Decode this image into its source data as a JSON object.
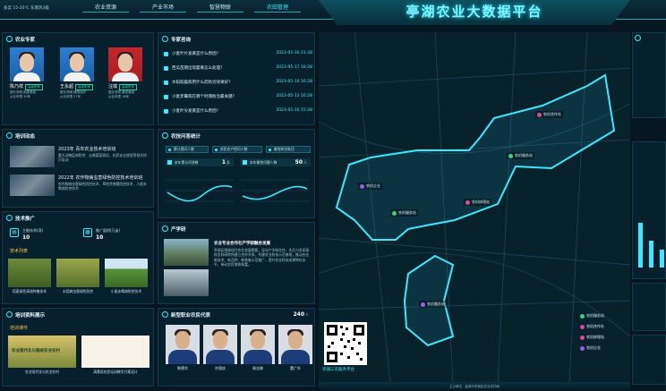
{
  "topbar": {
    "weather": "多云 15-20℃ 东南风3级",
    "nav": [
      {
        "label": "农业资源",
        "active": false
      },
      {
        "label": "产业市场",
        "active": false
      },
      {
        "label": "智慧物联",
        "active": false
      },
      {
        "label": "农田管理",
        "active": true
      }
    ],
    "title": "亭湖农业大数据平台"
  },
  "experts": {
    "title": "农业专家",
    "items": [
      {
        "name": "陈乃祥",
        "badge": "高级职称",
        "meta1": "擅长领域 稻麦栽培",
        "meta2": "从业年限 30年"
      },
      {
        "name": "王永超",
        "badge": "高级职称",
        "meta1": "擅长领域 植物保护",
        "meta2": "从业年限 27年"
      },
      {
        "name": "汪琪",
        "badge": "高级职称",
        "meta1": "擅长领域 蔬菜栽培",
        "meta2": "从业年限 18年"
      }
    ]
  },
  "training": {
    "title": "培训动态",
    "items": [
      {
        "title": "2023年 青年农业技术培训班",
        "text": "重大动物疫病防控、瓜果蔬菜栽培、农药安全使用等相关知识培训"
      },
      {
        "title": "2022年 农作物病虫害绿色防控技术培训班",
        "text": "农作物病虫害绿色防控技术、草地贪夜蛾防控技术、小麦赤霉病防控技术"
      }
    ]
  },
  "tech": {
    "title": "技术推广",
    "stat1": {
      "label": "主推技术(项)",
      "value": "10"
    },
    "stat2": {
      "label": "推广面积(万亩)",
      "value": "10"
    },
    "sub_head": "技术列表",
    "pictures": [
      {
        "caption": "稻麦绿色高效种植技术"
      },
      {
        "caption": "水稻病虫害绿色防控"
      },
      {
        "caption": "小麦赤霉病防控技术"
      }
    ]
  },
  "training_info": {
    "title": "培训资料展示",
    "sub_head": "培训课件",
    "cards": [
      {
        "title": "农业现代化与推进农业农村",
        "caption": "农业现代化与农业农村"
      },
      {
        "caption": "高素质农民培训教学方案设计"
      }
    ]
  },
  "consult": {
    "title": "专家咨询",
    "rows": [
      {
        "text": "小麦叶片发黄是什么原因?",
        "date": "2023-05-16 21:28"
      },
      {
        "text": "西瓜苗期出现萎蔫怎么处理?",
        "date": "2023-05-17 18:28"
      },
      {
        "text": "水稻稻瘟病用什么药防治效果好?",
        "date": "2023-05-14 16:28"
      },
      {
        "text": "小麦赤霉病在哪个时期防治最关键?",
        "date": "2023-05-13 16:28"
      },
      {
        "text": "小麦叶尖发黄是什么原因?",
        "date": "2023-05-10 15:28"
      }
    ]
  },
  "qa_stats": {
    "title": "农技问答统计",
    "tabs": [
      "累计提问人数",
      "农民农户提问人数",
      "解答知识条目"
    ],
    "stat1": {
      "label": "本年累计问答数",
      "value": "1",
      "unit": "条"
    },
    "stat2": {
      "label": "本年解答问题人数",
      "value": "50",
      "unit": "人"
    }
  },
  "industry": {
    "title": "产学研",
    "headline": "农业专业合作社产学研融合发展",
    "text": "亭湖区围绕现代农业发展需要，深化产学研合作，先后与多家高校及科研院所建立合作关系，共建农业科技示范基地，推动农业新技术、新品种、新装备示范推广，提升农业科技成果转化水平，带动农民增收致富。"
  },
  "members": {
    "title": "新型职业农民代表",
    "count": "240",
    "unit": "人",
    "people": [
      {
        "name": "陈德华"
      },
      {
        "name": "许国庆"
      },
      {
        "name": "周志刚"
      },
      {
        "name": "董广升"
      }
    ]
  },
  "map": {
    "labels": [
      {
        "text": "农机合作社",
        "tone": "#d94b9b"
      },
      {
        "text": "农机服务站",
        "tone": "#3ecf7a"
      },
      {
        "text": "农机企业",
        "tone": "#9b5de5"
      },
      {
        "text": "农机服务站",
        "tone": "#3ecf7a"
      },
      {
        "text": "农机修理站",
        "tone": "#d94b9b"
      },
      {
        "text": "农机服务站",
        "tone": "#3ecf7a"
      }
    ],
    "legend": [
      {
        "text": "农机服务站",
        "color": "#3ecf7a"
      },
      {
        "text": "农机合作社",
        "color": "#d94b9b"
      },
      {
        "text": "农机修理站",
        "color": "#d94b9b"
      },
      {
        "text": "农机企业",
        "color": "#9b5de5"
      }
    ],
    "qr_caption": "亭湖三农服务平台",
    "footer": "主办单位 · 盐城市亭湖区农业农村局"
  },
  "colors": {
    "accent": "#3ee8ff",
    "background": "#061722",
    "gold": "#f2c94c"
  }
}
